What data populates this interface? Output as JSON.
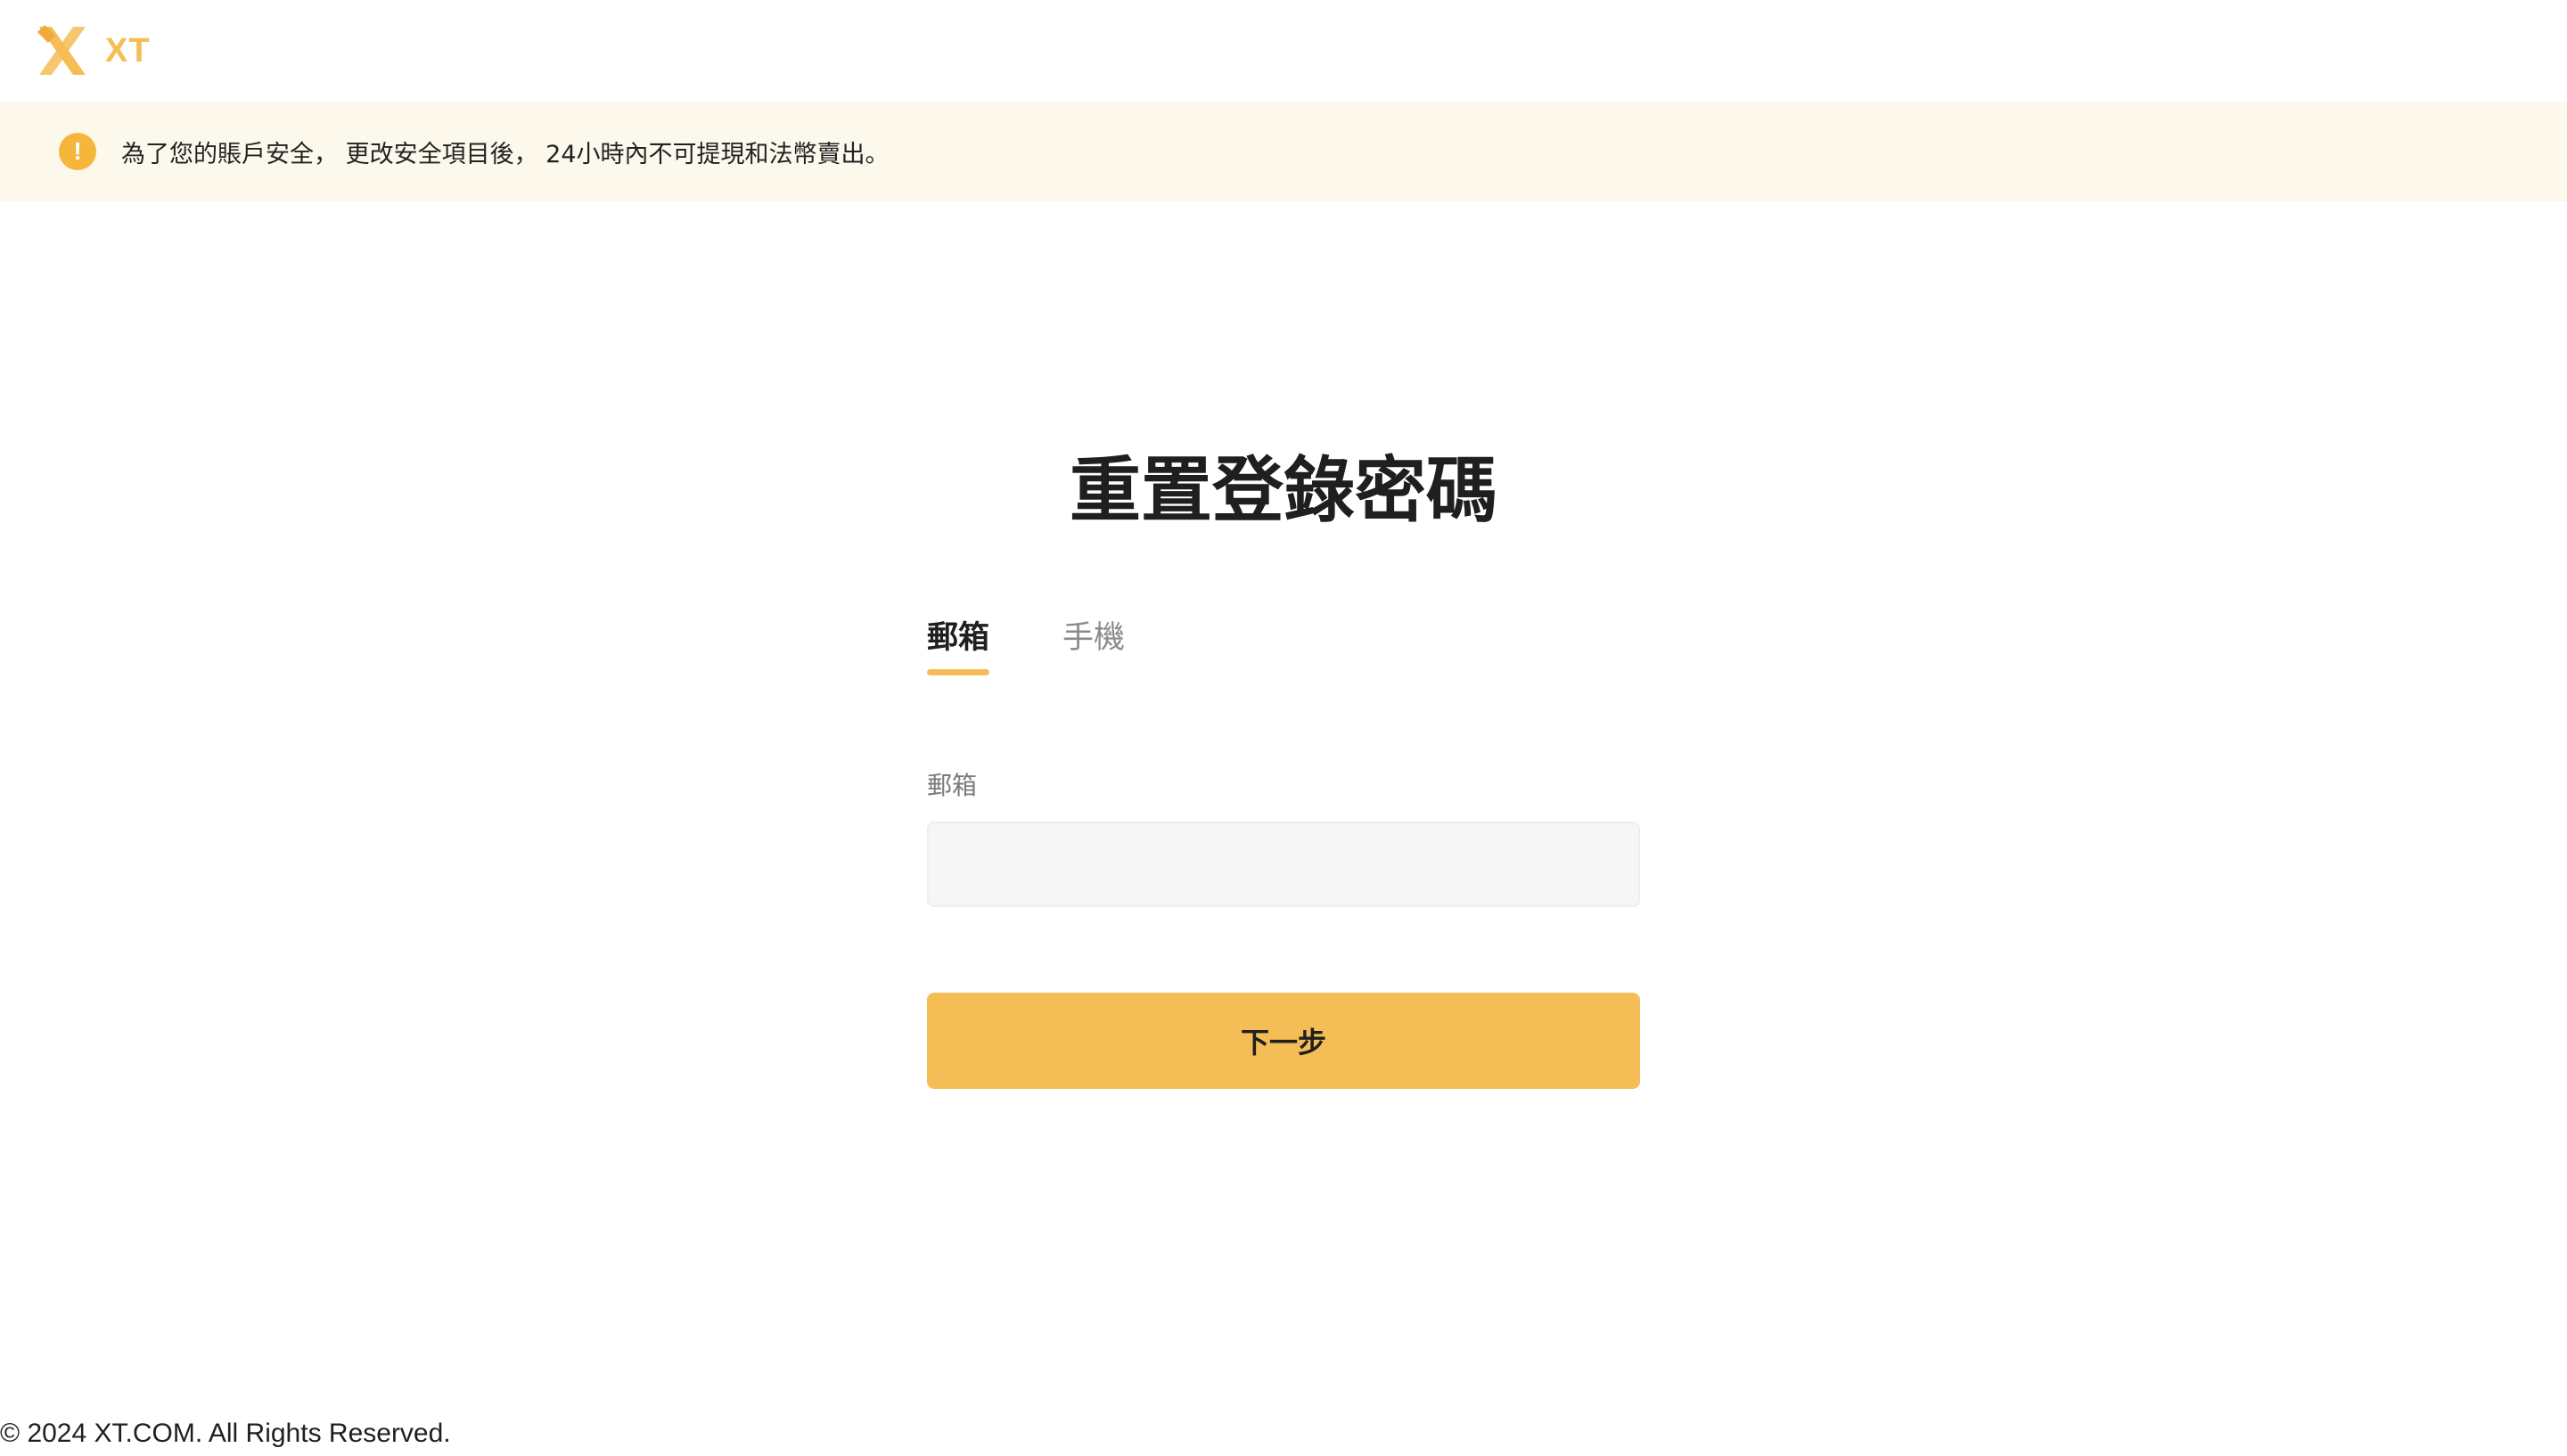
{
  "brand": {
    "logo_text": "XT",
    "accent_color": "#f5bd55"
  },
  "notice": {
    "icon": "exclamation-icon",
    "text": "為了您的賬戶安全， 更改安全項目後， 24小時內不可提現和法幣賣出。"
  },
  "main": {
    "title": "重置登錄密碼",
    "tabs": [
      {
        "label": "郵箱",
        "active": true
      },
      {
        "label": "手機",
        "active": false
      }
    ],
    "email_field": {
      "label": "郵箱",
      "value": "",
      "placeholder": ""
    },
    "next_button_label": "下一步"
  },
  "footer": {
    "copyright": "© 2024 XT.COM. All Rights Reserved."
  }
}
